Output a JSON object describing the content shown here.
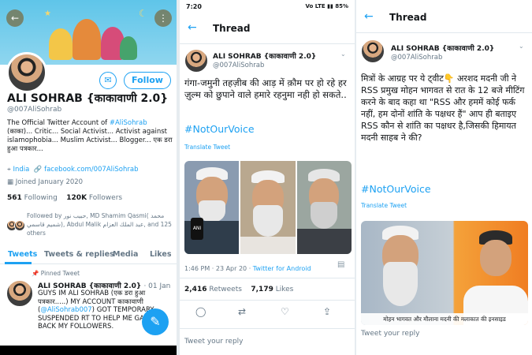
{
  "panel1": {
    "banner": {
      "back_icon": "arrow-left-icon",
      "more_icon": "more-vertical-icon"
    },
    "mail_icon": "mail-icon",
    "follow_label": "Follow",
    "name": "ALI SOHRAB {काकावाणी 2.0}",
    "handle": "@007AliSohrab",
    "bio_pre": "The Official Twitter Account of ",
    "bio_tag": "#AliSohrab",
    "bio_post": " (काका)... Critic... Social Activist... Activist against islamophobia... Muslim Activist... Blogger... एक डरा हुआ पत्रकार...",
    "location": "India",
    "website": "facebook.com/007AliSohrab",
    "joined": "Joined January 2020",
    "following_count": "561",
    "following_label": "Following",
    "followers_count": "120K",
    "followers_label": "Followers",
    "followed_by": "Followed by حبيب نور, MD Shamim Qasmi( محمد شميم قاسمي), Abdul Malik عبد الملك العزام, and 125 others",
    "tabs": [
      "Tweets",
      "Tweets & replies",
      "Media",
      "Likes"
    ],
    "pinned_label": "Pinned Tweet",
    "pinned_tweet": {
      "name": "ALI SOHRAB {काकावाणी 2.0}",
      "date": "· 01 Jan",
      "text_pre": "GUYS IM ALI SOHRAB (एक डरा हुआ पत्रकार.....) MY ACCOUNT काकावाणी (",
      "text_handle": "@AliSohrab007",
      "text_post": ") GOT TEMPORARY SUSPENDED RT TO HELP ME GAIN BACK MY FOLLOWERS."
    },
    "compose_icon": "feather-compose-icon"
  },
  "panel2": {
    "status": {
      "time": "7:20",
      "icons": "Vo LTE ▮▮ 85%"
    },
    "header_title": "Thread",
    "name": "ALI SOHRAB {काकावाणी 2.0}",
    "handle": "@007AliSohrab",
    "text": "गंगा-जमुनी तहज़ीब की आड़ में क़ौम पर हो रहे हर ज़ुल्म को छुपाने वाले हमारे रहनुमा नही हो सकते..",
    "hashtag": "#NotOurVoice",
    "translate": "Translate Tweet",
    "timestamp": "1:46 PM · 23 Apr 20 · ",
    "source": "Twitter for Android",
    "retweets_count": "2,416",
    "retweets_label": "Retweets",
    "likes_count": "7,179",
    "likes_label": "Likes",
    "reply_placeholder": "Tweet your reply"
  },
  "panel3": {
    "header_title": "Thread",
    "name": "ALI SOHRAB {काकावाणी 2.0}",
    "handle": "@007AliSohrab",
    "text": "मित्रों के आग्रह पर ये ट्वीट👇 अरशद मदनी जी ने RSS प्रमुख मोहन भागवत से रात के 12 बजे मीटिंग करने के बाद कहा था \"RSS और हममें कोई फर्क नहीं, हम दोनों शांति के पक्षधर हैं\" आप ही बताइए RSS कौन से शांति का पक्षधर है,जिसकी हिमायत मदनी साहब ने की?",
    "hashtag": "#NotOurVoice",
    "translate": "Translate Tweet",
    "image_caption": "मोहन भागवत और मौलाना मदनी की मलाकात की इनसाइड",
    "reply_placeholder": "Tweet your reply"
  }
}
